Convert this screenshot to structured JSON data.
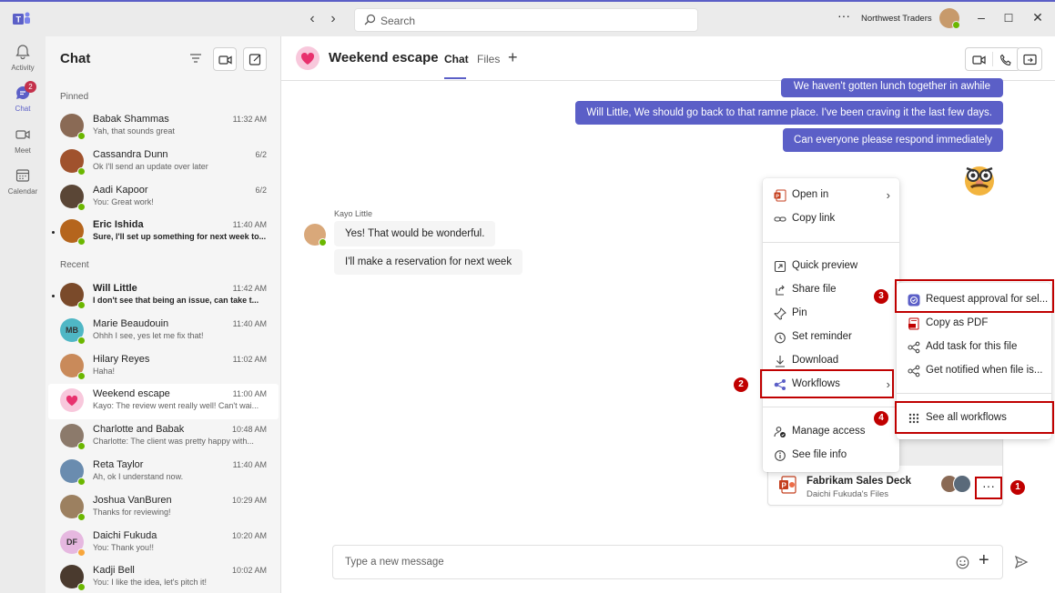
{
  "titlebar": {
    "search_placeholder": "Search",
    "more_label": "···",
    "org_name": "Northwest Traders"
  },
  "rail": {
    "items": [
      {
        "label": "Activity"
      },
      {
        "label": "Chat",
        "badge": "2"
      },
      {
        "label": "Meet"
      },
      {
        "label": "Calendar"
      }
    ]
  },
  "chatlist": {
    "title": "Chat",
    "pinned_label": "Pinned",
    "recent_label": "Recent",
    "pinned": [
      {
        "name": "Babak Shammas",
        "preview": "Yah, that sounds great",
        "time": "11:32 AM",
        "color": "#8a6a55"
      },
      {
        "name": "Cassandra Dunn",
        "preview": "Ok I'll send an update over later",
        "time": "6/2",
        "color": "#a0522d"
      },
      {
        "name": "Aadi Kapoor",
        "preview": "You: Great work!",
        "time": "6/2",
        "color": "#5a4636"
      },
      {
        "name": "Eric Ishida",
        "preview": "Sure, I'll set up something for next week to...",
        "time": "11:40 AM",
        "color": "#b5651d",
        "unread": true
      }
    ],
    "recent": [
      {
        "name": "Will Little",
        "preview": "I don't see that being an issue, can take t...",
        "time": "11:42 AM",
        "color": "#7a4a2a",
        "unread": true
      },
      {
        "name": "Marie Beaudouin",
        "preview": "Ohhh I see, yes let me fix that!",
        "time": "11:40 AM",
        "initials": "MB",
        "color": "#4fb7c5"
      },
      {
        "name": "Hilary Reyes",
        "preview": "Haha!",
        "time": "11:02 AM",
        "color": "#c98a5a"
      },
      {
        "name": "Weekend escape",
        "preview": "Kayo: The review went really well! Can't wai...",
        "time": "11:00 AM",
        "color": "#f8c8dc"
      },
      {
        "name": "Charlotte and Babak",
        "preview": "Charlotte: The client was pretty happy with...",
        "time": "10:48 AM",
        "color": "#8c7a6b"
      },
      {
        "name": "Reta Taylor",
        "preview": "Ah, ok I understand now.",
        "time": "11:40 AM",
        "color": "#6a8caf"
      },
      {
        "name": "Joshua VanBuren",
        "preview": "Thanks for reviewing!",
        "time": "10:29 AM",
        "color": "#9c8060"
      },
      {
        "name": "Daichi Fukuda",
        "preview": "You: Thank you!!",
        "time": "10:20 AM",
        "initials": "DF",
        "color": "#e6b8e0"
      },
      {
        "name": "Kadji Bell",
        "preview": "You: I like the idea, let's pitch it!",
        "time": "10:02 AM",
        "color": "#4a3a2e"
      }
    ]
  },
  "main": {
    "title": "Weekend escape",
    "tabs": [
      "Chat",
      "Files"
    ],
    "my_messages": [
      "We haven't gotten lunch together in awhile",
      "Will Little, We should go back to that ramne place. I've been craving it the last few days.",
      "Can everyone please respond immediately"
    ],
    "sender": "Kayo Little",
    "their_messages": [
      "Yes! That would be wonderful.",
      "I'll make a reservation for next week"
    ],
    "file": {
      "name": "Fabrikam Sales Deck",
      "sub": "Daichi Fukuda's Files"
    },
    "composer_placeholder": "Type a new message"
  },
  "context_menu": {
    "group1": [
      {
        "label": "Open in",
        "icon": "powerpoint-icon",
        "submenu": true
      },
      {
        "label": "Copy link",
        "icon": "link-icon"
      }
    ],
    "group2": [
      {
        "label": "Quick preview",
        "icon": "preview-icon"
      },
      {
        "label": "Share file",
        "icon": "share-icon"
      },
      {
        "label": "Pin",
        "icon": "pin-icon"
      },
      {
        "label": "Set reminder",
        "icon": "clock-icon"
      },
      {
        "label": "Download",
        "icon": "download-icon"
      },
      {
        "label": "Workflows",
        "icon": "workflow-icon",
        "submenu": true
      }
    ],
    "group3": [
      {
        "label": "Manage access",
        "icon": "manage-access-icon"
      },
      {
        "label": "See file info",
        "icon": "info-icon"
      }
    ]
  },
  "submenu": {
    "items": [
      {
        "label": "Request approval for sel...",
        "icon": "approval-icon"
      },
      {
        "label": "Copy as PDF",
        "icon": "pdf-icon"
      },
      {
        "label": "Add task for this file",
        "icon": "task-icon"
      },
      {
        "label": "Get notified when file is...",
        "icon": "notify-icon"
      }
    ],
    "see_all": "See all workflows"
  },
  "callouts": [
    "1",
    "2",
    "3",
    "4"
  ],
  "colors": {
    "accent": "#5b5fc7",
    "highlight": "#c00000",
    "presence": "#6bb700"
  }
}
